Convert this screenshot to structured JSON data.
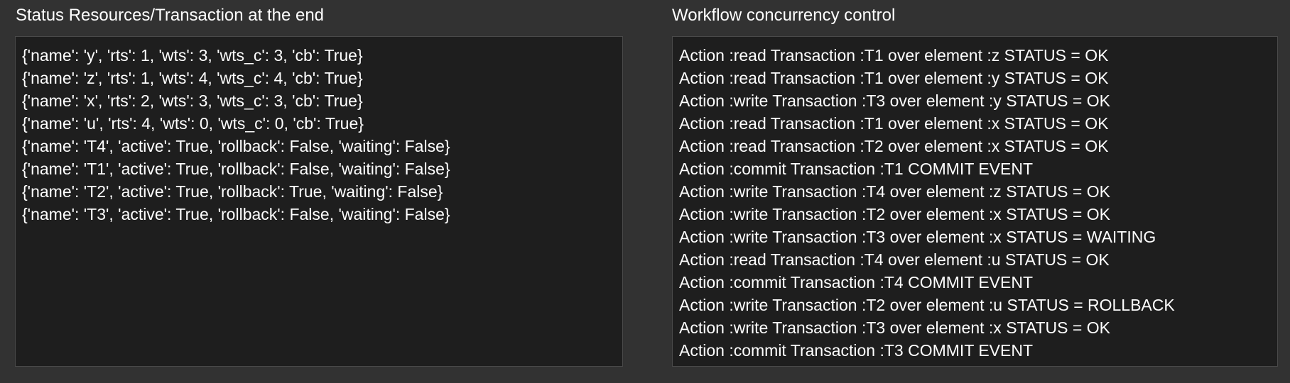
{
  "left_panel": {
    "title": "Status Resources/Transaction at the end",
    "lines": [
      "{'name': 'y', 'rts': 1, 'wts': 3, 'wts_c': 3, 'cb': True}",
      "{'name': 'z', 'rts': 1, 'wts': 4, 'wts_c': 4, 'cb': True}",
      "{'name': 'x', 'rts': 2, 'wts': 3, 'wts_c': 3, 'cb': True}",
      "{'name': 'u', 'rts': 4, 'wts': 0, 'wts_c': 0, 'cb': True}",
      "{'name': 'T4', 'active': True, 'rollback': False, 'waiting': False}",
      "{'name': 'T1', 'active': True, 'rollback': False, 'waiting': False}",
      "{'name': 'T2', 'active': True, 'rollback': True, 'waiting': False}",
      "{'name': 'T3', 'active': True, 'rollback': False, 'waiting': False}"
    ]
  },
  "right_panel": {
    "title": "Workflow concurrency control",
    "lines": [
      "Action :read Transaction :T1 over element :z STATUS = OK",
      "Action :read Transaction :T1 over element :y STATUS = OK",
      "Action :write Transaction :T3 over element :y STATUS = OK",
      "Action :read Transaction :T1 over element :x STATUS = OK",
      "Action :read Transaction :T2 over element :x STATUS = OK",
      "Action :commit Transaction :T1 COMMIT EVENT",
      "Action :write Transaction :T4 over element :z STATUS = OK",
      "Action :write Transaction :T2 over element :x STATUS = OK",
      "Action :write Transaction :T3 over element :x STATUS = WAITING",
      "Action :read Transaction :T4 over element :u STATUS = OK",
      "Action :commit Transaction :T4 COMMIT EVENT",
      "Action :write Transaction :T2 over element :u STATUS = ROLLBACK",
      "Action :write Transaction :T3 over element :x STATUS = OK",
      "Action :commit Transaction :T3 COMMIT EVENT"
    ]
  }
}
